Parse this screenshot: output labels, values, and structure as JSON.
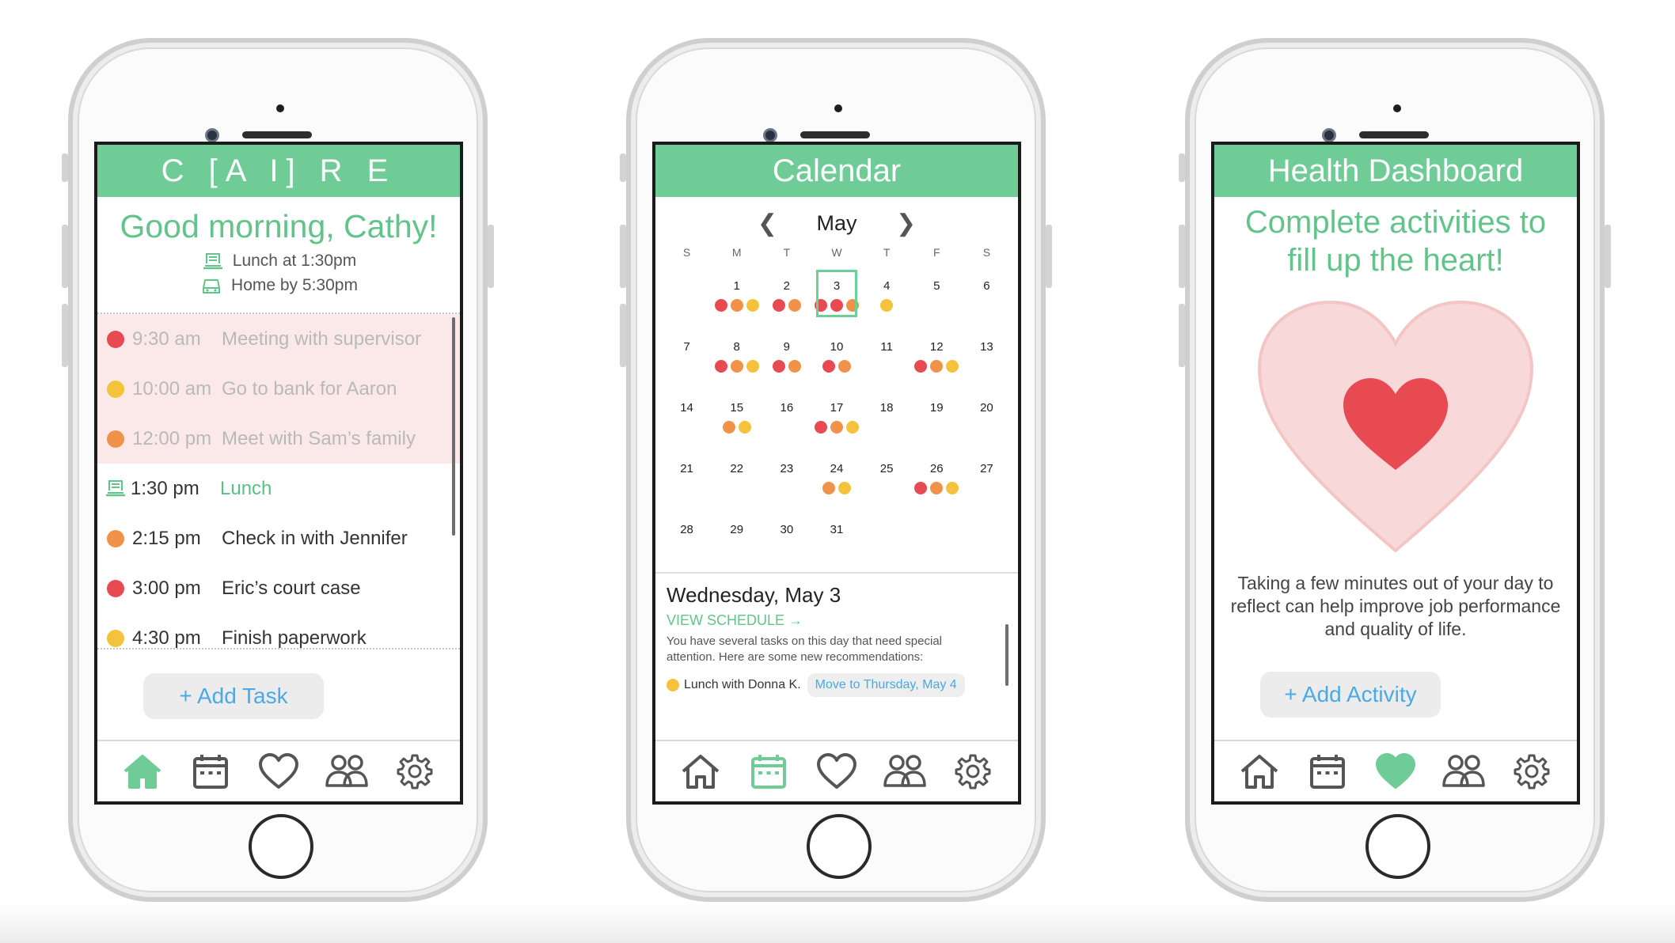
{
  "colors": {
    "accent": "#70cc97",
    "red": "#e84a52",
    "orange": "#f0924a",
    "yellow": "#f5c33b",
    "link": "#4ba9e6"
  },
  "home": {
    "title": "C [A I] R E",
    "greeting": "Good morning, Cathy!",
    "reminders": [
      {
        "icon": "meal-icon",
        "text": "Lunch at 1:30pm"
      },
      {
        "icon": "car-icon",
        "text": "Home by 5:30pm"
      }
    ],
    "tasks": [
      {
        "time": "9:30 am",
        "name": "Meeting with supervisor",
        "color": "red",
        "past": true
      },
      {
        "time": "10:00 am",
        "name": "Go to bank for Aaron",
        "color": "yellow",
        "past": true
      },
      {
        "time": "12:00 pm",
        "name": "Meet with Sam’s family",
        "color": "orange",
        "past": true
      },
      {
        "time": "1:30 pm",
        "name": "Lunch",
        "icon": "meal-icon",
        "past": false
      },
      {
        "time": "2:15 pm",
        "name": "Check in with Jennifer",
        "color": "orange",
        "past": false
      },
      {
        "time": "3:00 pm",
        "name": "Eric’s court case",
        "color": "red",
        "past": false
      },
      {
        "time": "4:30 pm",
        "name": "Finish paperwork",
        "color": "yellow",
        "past": false
      }
    ],
    "add_task_label": "+ Add Task"
  },
  "calendar": {
    "title": "Calendar",
    "month": "May",
    "weekdays": [
      "S",
      "M",
      "T",
      "W",
      "T",
      "F",
      "S"
    ],
    "selected_day": "3",
    "weeks": [
      [
        {
          "d": "",
          "dots": []
        },
        {
          "d": "1",
          "dots": [
            "red",
            "orange",
            "yellow"
          ]
        },
        {
          "d": "2",
          "dots": [
            "red",
            "orange"
          ]
        },
        {
          "d": "3",
          "dots": [
            "red",
            "red",
            "orange"
          ]
        },
        {
          "d": "4",
          "dots": [
            "yellow"
          ]
        },
        {
          "d": "5",
          "dots": []
        },
        {
          "d": "6",
          "dots": []
        }
      ],
      [
        {
          "d": "7",
          "dots": []
        },
        {
          "d": "8",
          "dots": [
            "red",
            "orange",
            "yellow"
          ]
        },
        {
          "d": "9",
          "dots": [
            "red",
            "orange"
          ]
        },
        {
          "d": "10",
          "dots": [
            "red",
            "orange"
          ]
        },
        {
          "d": "11",
          "dots": []
        },
        {
          "d": "12",
          "dots": [
            "red",
            "orange",
            "yellow"
          ]
        },
        {
          "d": "13",
          "dots": []
        }
      ],
      [
        {
          "d": "14",
          "dots": []
        },
        {
          "d": "15",
          "dots": [
            "orange",
            "yellow"
          ]
        },
        {
          "d": "16",
          "dots": []
        },
        {
          "d": "17",
          "dots": [
            "red",
            "orange",
            "yellow"
          ]
        },
        {
          "d": "18",
          "dots": []
        },
        {
          "d": "19",
          "dots": []
        },
        {
          "d": "20",
          "dots": []
        }
      ],
      [
        {
          "d": "21",
          "dots": []
        },
        {
          "d": "22",
          "dots": []
        },
        {
          "d": "23",
          "dots": []
        },
        {
          "d": "24",
          "dots": [
            "orange",
            "yellow"
          ]
        },
        {
          "d": "25",
          "dots": []
        },
        {
          "d": "26",
          "dots": [
            "red",
            "orange",
            "yellow"
          ]
        },
        {
          "d": "27",
          "dots": []
        }
      ],
      [
        {
          "d": "28",
          "dots": []
        },
        {
          "d": "29",
          "dots": []
        },
        {
          "d": "30",
          "dots": []
        },
        {
          "d": "31",
          "dots": []
        },
        {
          "d": "",
          "dots": []
        },
        {
          "d": "",
          "dots": []
        },
        {
          "d": "",
          "dots": []
        }
      ]
    ],
    "detail_title": "Wednesday, May 3",
    "view_schedule": "VIEW SCHEDULE →",
    "note": "You have several tasks on this day that need special attention. Here are some new recommendations:",
    "recommendation": "Lunch with Donna K.",
    "move_label": "Move to Thursday, May 4"
  },
  "health": {
    "title": "Health Dashboard",
    "headline": "Complete activities to fill up the heart!",
    "body": "Taking a few minutes out of your day to reflect can help improve job performance and quality of life.",
    "add_activity_label": "+ Add Activity"
  },
  "tabs": [
    "home-icon",
    "calendar-icon",
    "heart-icon",
    "people-icon",
    "gear-icon"
  ]
}
